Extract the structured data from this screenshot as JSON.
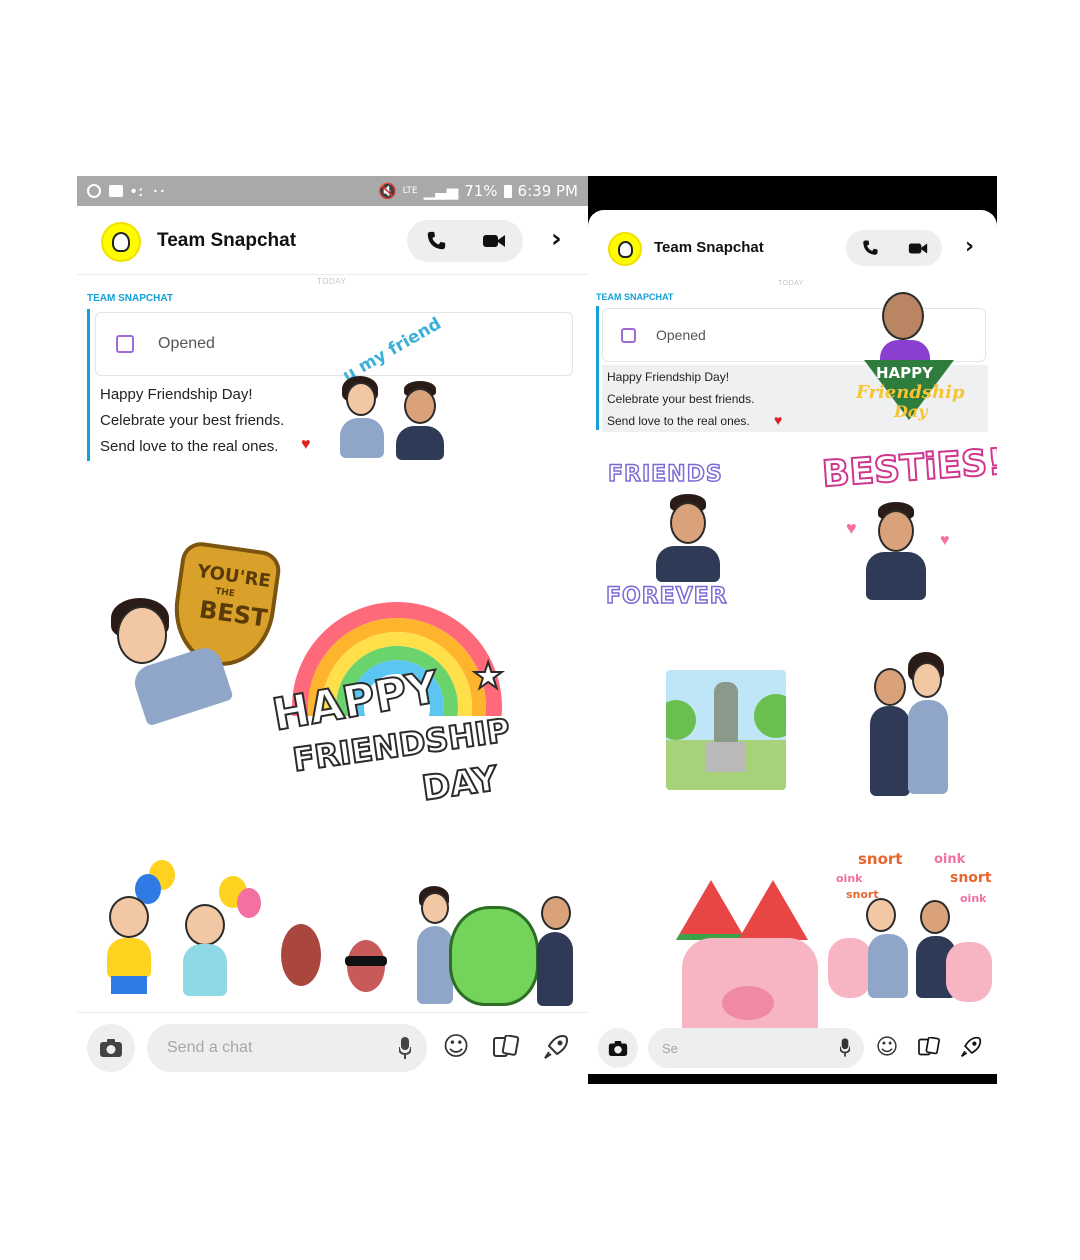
{
  "left": {
    "status_bar": {
      "battery": "71%",
      "time": "6:39 PM",
      "network": "LTE"
    },
    "header": {
      "title": "Team Snapchat"
    },
    "today_label": "TODAY",
    "sender": "TEAM SNAPCHAT",
    "message": {
      "status": "Opened",
      "lines": [
        "Happy Friendship Day!",
        "Celebrate your best friends.",
        "Send love to the real ones."
      ]
    },
    "stickers": {
      "u_my_friend": "u my friend",
      "youre_the_best_1": "YOU'RE",
      "youre_the_best_2": "THE",
      "youre_the_best_3": "BEST",
      "hfd_1": "HAPPY",
      "hfd_2": "FRIENDSHIP",
      "hfd_3": "DAY"
    },
    "input": {
      "placeholder": "Send a chat"
    }
  },
  "right": {
    "header": {
      "title": "Team Snapchat"
    },
    "today_label": "TODAY",
    "sender": "TEAM SNAPCHAT",
    "message": {
      "status": "Opened",
      "lines": [
        "Happy Friendship Day!",
        "Celebrate your best friends.",
        "Send love to the real ones."
      ]
    },
    "stickers": {
      "happy": "HAPPY",
      "friendship": "Friendship",
      "day": "Day",
      "friends": "FRIENDS",
      "forever": "FOREVER",
      "besties": "BESTiES!",
      "snort1": "snort",
      "oink1": "oink",
      "oink2": "oink",
      "snort2": "snort",
      "snort3": "snort",
      "oink3": "oink"
    },
    "input": {
      "placeholder": "Se"
    }
  },
  "colors": {
    "snap_yellow": "#fffc00",
    "accent_blue": "#16a0d8",
    "check_purple": "#a06ad6",
    "heart": "#e02020"
  }
}
